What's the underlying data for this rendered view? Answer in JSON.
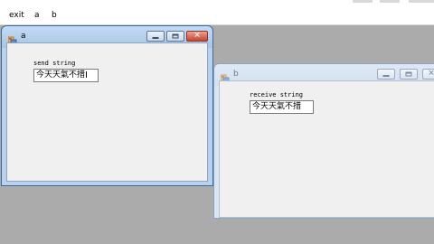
{
  "menu": {
    "items": [
      {
        "label": "exit"
      },
      {
        "label": "a"
      },
      {
        "label": "b"
      }
    ]
  },
  "windows": {
    "a": {
      "title": "a",
      "label": "send string",
      "value": "今天天氣不措",
      "active": true
    },
    "b": {
      "title": "b",
      "label": "receive string",
      "value": "今天天氣不措",
      "active": false
    }
  },
  "colors": {
    "mdi_background": "#ababab",
    "active_frame": "#a9c6e6",
    "inactive_frame": "#d2e0f0",
    "close_button": "#c7452f"
  },
  "icons": [
    "window-app-icon",
    "minimize-icon",
    "maximize-icon",
    "close-icon",
    "text-cursor-icon"
  ]
}
